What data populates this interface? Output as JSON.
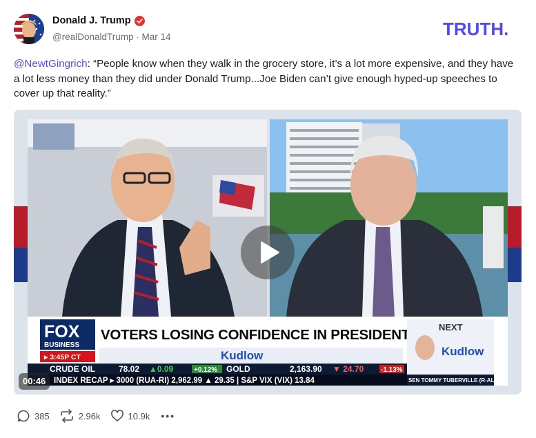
{
  "post": {
    "author": {
      "display_name": "Donald J. Trump",
      "handle": "@realDonaldTrump",
      "date": "Mar 14",
      "separator": "·"
    },
    "logo_text": "TRUTH.",
    "text_mention": "@NewtGingrich",
    "text_body": ": “People know when they walk in the grocery store, it’s a lot more expensive, and they have a lot less money than they did under Donald Trump...Joe Biden can’t give enough hyped-up speeches to cover up that reality.”",
    "video": {
      "elapsed": "00:46",
      "logo_fox": "FOX",
      "logo_business": "BUSINESS",
      "show_time": "▸ 3:45P CT",
      "headline": "VOTERS LOSING CONFIDENCE IN PRESIDENT BIDEN",
      "show_name": "Kudlow",
      "next_label": "NEXT",
      "next_show": "Kudlow",
      "next_guest": "SEN TOMMY TUBERVILLE (R-AL)",
      "ticker_row1": [
        {
          "label": "CRUDE OIL",
          "value": "78.02",
          "change": "▲0.09",
          "pct": "+0.12%"
        },
        {
          "label": "GOLD",
          "value": "2,163.90",
          "change": "▼ 24.70",
          "pct": "-1.13%"
        }
      ],
      "ticker_row2": "INDEX RECAP ▸ 3000 (RUA-RI) 2,962.99 ▲ 29.35 | S&P VIX (VIX) 13.84"
    },
    "actions": {
      "replies": "385",
      "retruths": "2.96k",
      "likes": "10.9k",
      "more": "•••"
    },
    "colors": {
      "accent": "#5448ee",
      "fox_blue": "#0b2a66",
      "alert_red": "#d5151b"
    }
  }
}
